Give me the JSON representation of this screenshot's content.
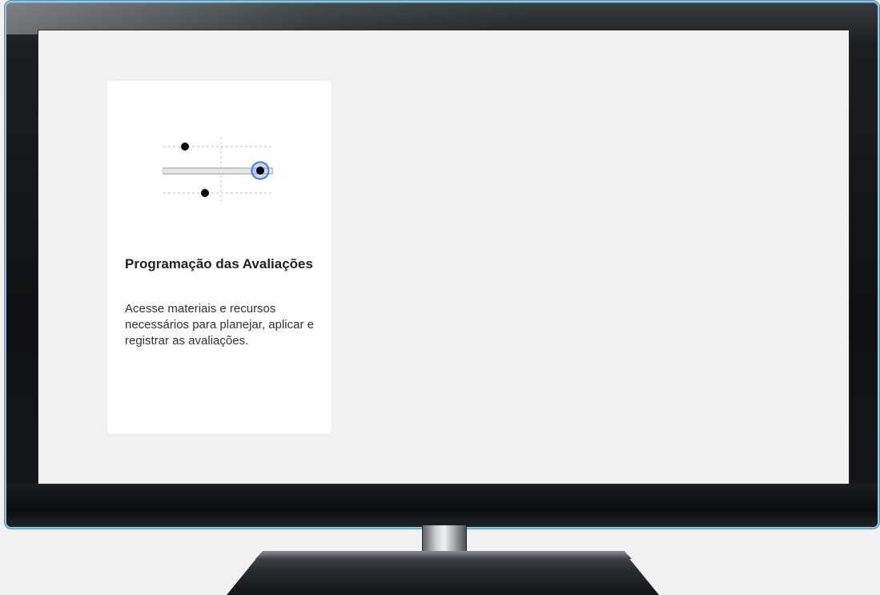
{
  "card": {
    "title": "Programação das Avaliações",
    "description": "Acesse materiais e recursos necessários para planejar, aplicar e registrar as avaliações.",
    "icon": "sliders-icon",
    "accent_color": "#4a7fe0"
  }
}
